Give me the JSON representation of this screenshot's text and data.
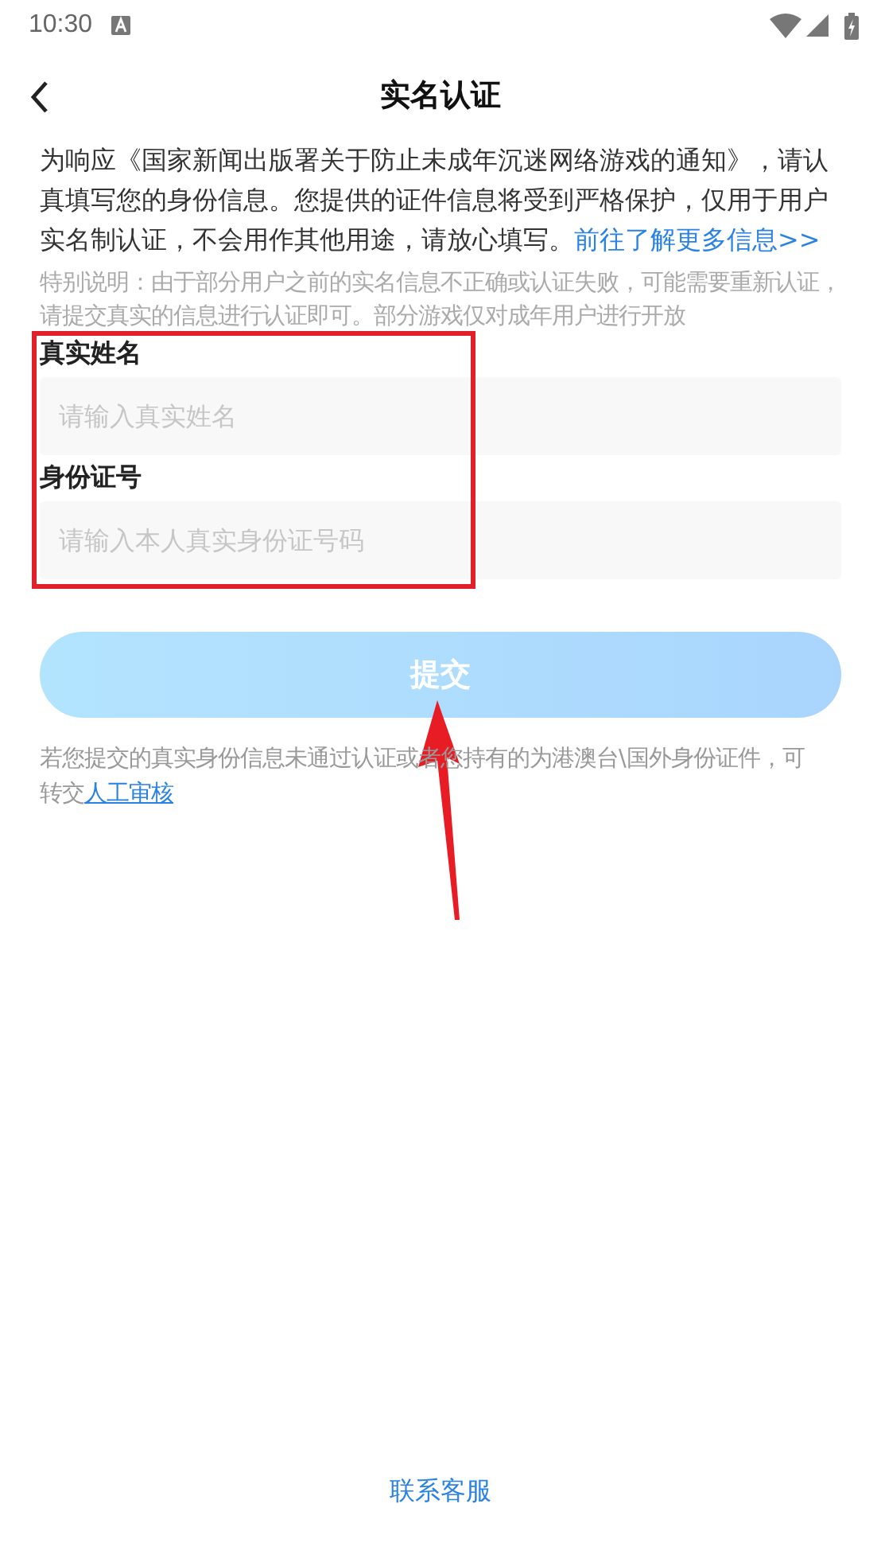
{
  "status_bar": {
    "time": "10:30"
  },
  "header": {
    "title": "实名认证"
  },
  "intro": {
    "text": "为响应《国家新闻出版署关于防止未成年沉迷网络游戏的通知》，请认真填写您的身份信息。您提供的证件信息将受到严格保护，仅用于用户实名制认证，不会用作其他用途，请放心填写。",
    "link": "前往了解更多信息>>"
  },
  "special_note": "特别说明：由于部分用户之前的实名信息不正确或认证失败，可能需要重新认证，请提交真实的信息进行认证即可。部分游戏仅对成年用户进行开放",
  "fields": [
    {
      "label": "真实姓名",
      "placeholder": "请输入真实姓名"
    },
    {
      "label": "身份证号",
      "placeholder": "请输入本人真实身份证号码"
    }
  ],
  "submit": {
    "label": "提交",
    "disabled": true
  },
  "manual_note": {
    "text": "若您提交的真实身份信息未通过认证或者您持有的为港澳台\\国外身份证件，可转交",
    "link": "人工审核"
  },
  "contact": "联系客服"
}
